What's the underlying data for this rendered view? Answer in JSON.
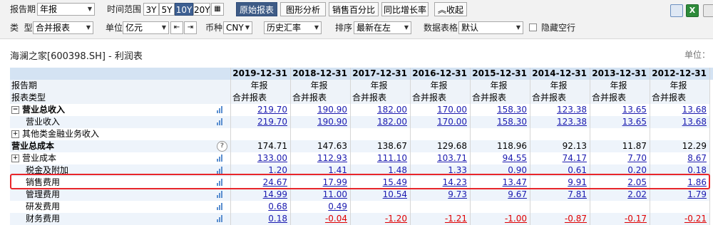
{
  "toolbar": {
    "report_period_label": "报告期",
    "report_period_value": "年报",
    "time_range_label": "时间范围",
    "time_ranges": [
      "3Y",
      "5Y",
      "10Y",
      "20Y"
    ],
    "time_range_active": "10Y",
    "tabs": [
      "原始报表",
      "图形分析",
      "销售百分比",
      "同比增长率"
    ],
    "tab_active": "原始报表",
    "collapse_label": "收起",
    "type_label": "类  型",
    "type_value": "合并报表",
    "unit_label": "单位",
    "unit_value": "亿元",
    "currency_label": "币种",
    "currency_value": "CNY",
    "fx_value": "历史汇率",
    "sort_label": "排序",
    "sort_value": "最新在左",
    "datagrid_label": "数据表格",
    "datagrid_value": "默认",
    "hide_empty_label": "隐藏空行"
  },
  "title": "海澜之家[600398.SH] - 利润表",
  "unit_text": "单位：",
  "columns": [
    "2019-12-31",
    "2018-12-31",
    "2017-12-31",
    "2016-12-31",
    "2015-12-31",
    "2014-12-31",
    "2013-12-31",
    "2012-12-31"
  ],
  "rows": [
    {
      "name": "报告期",
      "values": [
        "年报",
        "年报",
        "年报",
        "年报",
        "年报",
        "年报",
        "年报",
        "年报"
      ]
    },
    {
      "name": "报表类型",
      "values": [
        "合并报表",
        "合并报表",
        "合并报表",
        "合并报表",
        "合并报表",
        "合并报表",
        "合并报表",
        "合并报表"
      ]
    },
    {
      "name": "营业总收入",
      "values": [
        "219.70",
        "190.90",
        "182.00",
        "170.00",
        "158.30",
        "123.38",
        "13.65",
        "13.68"
      ]
    },
    {
      "name": "营业收入",
      "values": [
        "219.70",
        "190.90",
        "182.00",
        "170.00",
        "158.30",
        "123.38",
        "13.65",
        "13.68"
      ]
    },
    {
      "name": "其他类金融业务收入",
      "values": [
        "",
        "",
        "",
        "",
        "",
        "",
        "",
        ""
      ]
    },
    {
      "name": "营业总成本",
      "values": [
        "174.71",
        "147.63",
        "138.67",
        "129.68",
        "118.96",
        "92.13",
        "11.87",
        "12.29"
      ]
    },
    {
      "name": "营业成本",
      "values": [
        "133.00",
        "112.93",
        "111.10",
        "103.71",
        "94.55",
        "74.17",
        "7.70",
        "8.67"
      ]
    },
    {
      "name": "税金及附加",
      "values": [
        "1.20",
        "1.41",
        "1.48",
        "1.33",
        "0.90",
        "0.61",
        "0.20",
        "0.18"
      ]
    },
    {
      "name": "销售费用",
      "values": [
        "24.67",
        "17.99",
        "15.49",
        "14.23",
        "13.47",
        "9.91",
        "2.05",
        "1.86"
      ]
    },
    {
      "name": "管理费用",
      "values": [
        "14.99",
        "11.00",
        "10.54",
        "9.73",
        "9.67",
        "7.81",
        "2.02",
        "1.79"
      ]
    },
    {
      "name": "研发费用",
      "values": [
        "0.68",
        "0.49",
        "",
        "",
        "",
        "",
        "",
        ""
      ]
    },
    {
      "name": "财务费用",
      "values": [
        "0.18",
        "-0.04",
        "-1.20",
        "-1.21",
        "-1.00",
        "-0.87",
        "-0.17",
        "-0.21"
      ]
    }
  ]
}
